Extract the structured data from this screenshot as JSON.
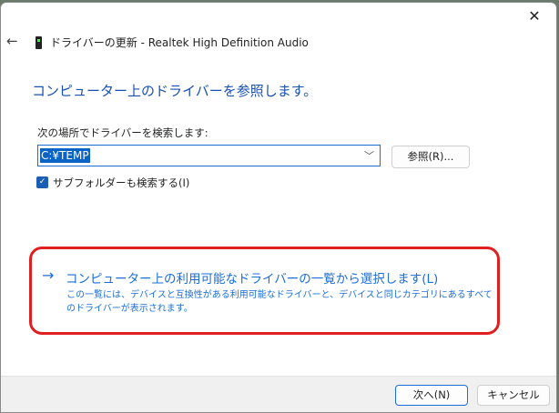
{
  "window": {
    "title": "ドライバーの更新 - Realtek High Definition Audio",
    "close_glyph": "✕",
    "back_glyph": "←"
  },
  "main": {
    "heading": "コンピューター上のドライバーを参照します。",
    "search_label": "次の場所でドライバーを検索します:",
    "path_value": "C:¥TEMP",
    "browse_label": "参照(R)...",
    "subfolder_label": "サブフォルダーも検索する(I)",
    "subfolder_checked": true,
    "pick_link": "コンピューター上の利用可能なドライバーの一覧から選択します(L)",
    "pick_desc": "この一覧には、デバイスと互換性がある利用可能なドライバーと、デバイスと同じカテゴリにあるすべてのドライバーが表示されます。"
  },
  "footer": {
    "next_label": "次へ(N)",
    "cancel_label": "キャンセル"
  },
  "colors": {
    "accent": "#1a6ed8",
    "heading": "#1a50b0",
    "highlight": "#e02020"
  }
}
